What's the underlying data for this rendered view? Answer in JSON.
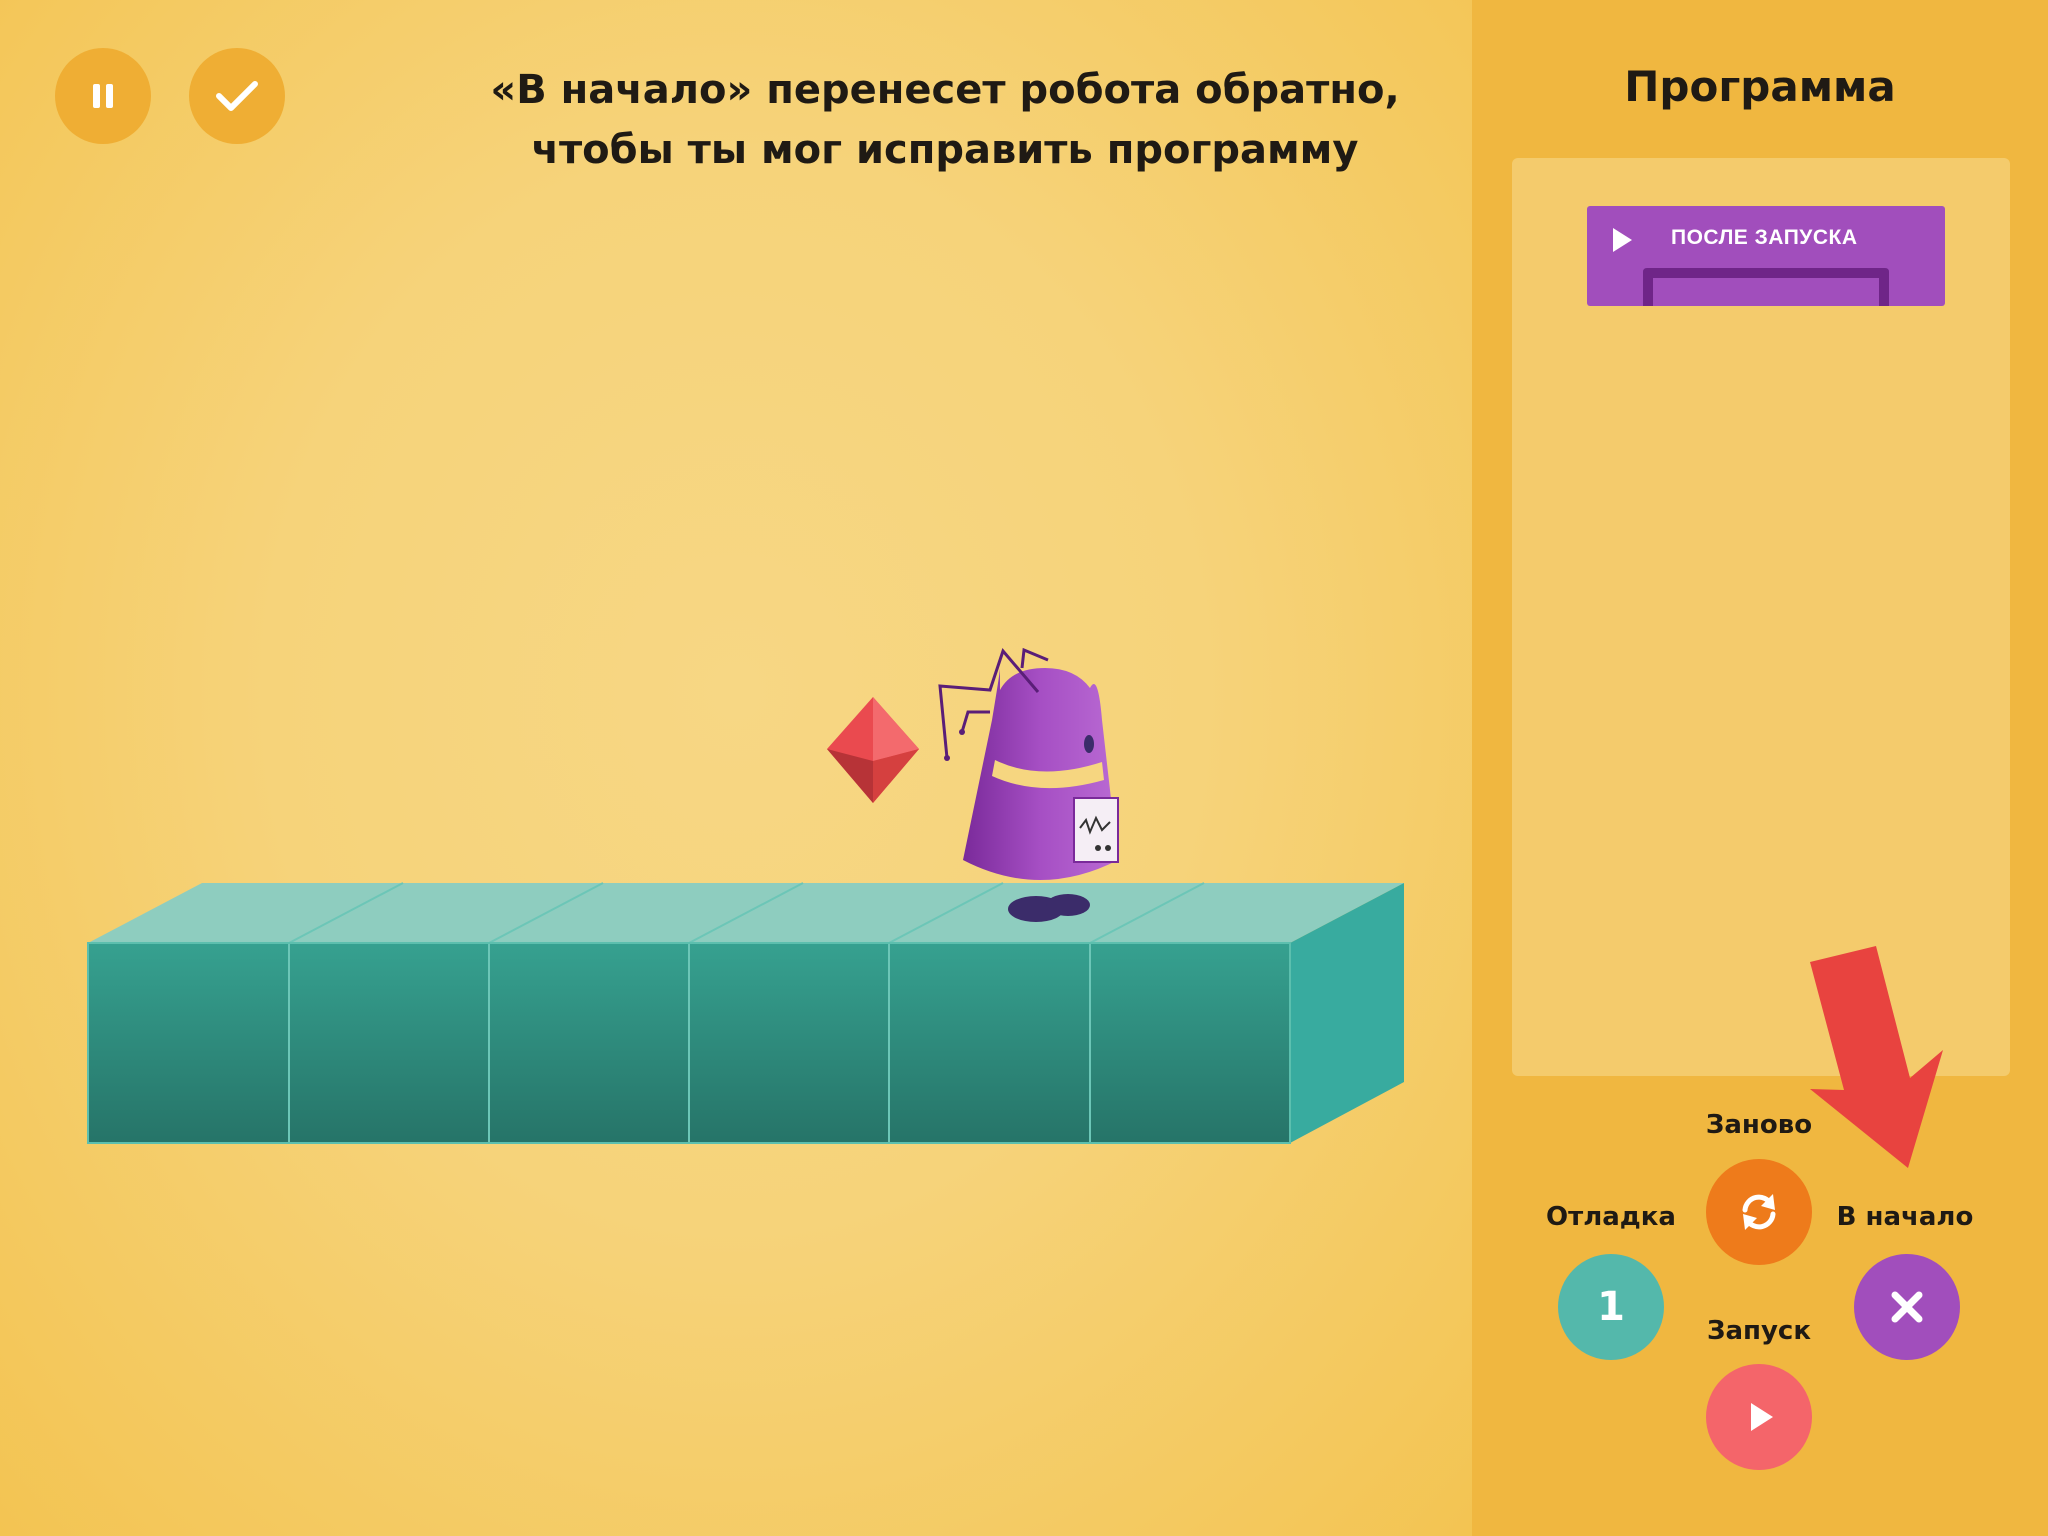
{
  "toolbar": {
    "pause_icon": "pause-icon",
    "check_icon": "check-icon"
  },
  "instruction": {
    "line1": "«В начало» перенесет робота обратно,",
    "line2": "чтобы ты мог исправить программу"
  },
  "sidebar": {
    "title": "Программа",
    "start_block": {
      "label": "ПОСЛЕ ЗАПУСКА",
      "icon": "play-icon",
      "color": "#a14ebc"
    }
  },
  "controls": {
    "reset": {
      "label": "Заново",
      "icon": "refresh-icon",
      "color": "#ee7b1b"
    },
    "debug": {
      "label": "Отладка",
      "value": "1",
      "color": "#54b8ab"
    },
    "to_start": {
      "label": "В начало",
      "icon": "close-icon",
      "color": "#a14ebc"
    },
    "run": {
      "label": "Запуск",
      "icon": "play-icon",
      "color": "#f4656a"
    }
  },
  "scene": {
    "platform_tiles": 6,
    "platform_color": "#2f9d8f",
    "gem_color": "#ea4a4f",
    "robot_color": "#9a3fb4"
  },
  "hint_arrow": {
    "color": "#e8433f"
  }
}
